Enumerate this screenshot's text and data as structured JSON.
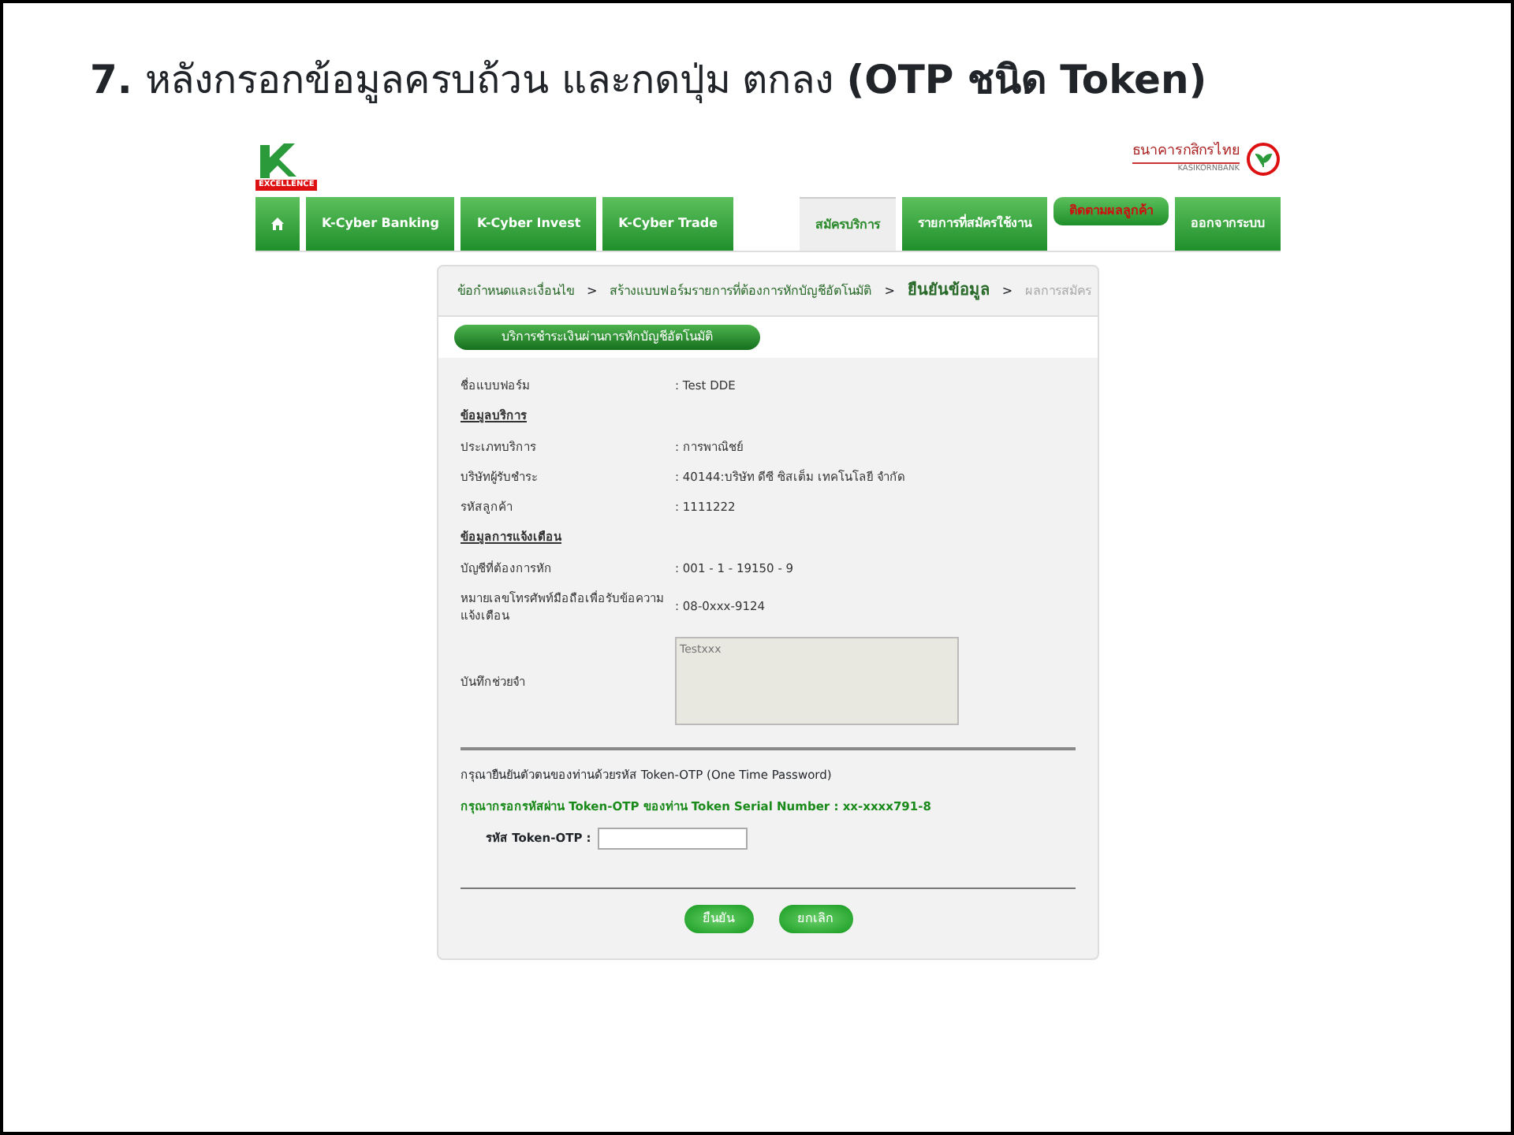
{
  "slide": {
    "title": "**7.** หลังกรอกข้อมูลครบถ้วน และกดปุ่ม ตกลง **(OTP ชนิด Token)**"
  },
  "header": {
    "logo_caption": "EXCELLENCE",
    "bank_name": "ธนาคารกสิกรไทย",
    "bank_name_en": "KASIKORNBANK"
  },
  "nav_left": [
    {
      "kind": "home"
    },
    {
      "kind": "text",
      "label": "K-Cyber Banking"
    },
    {
      "kind": "text",
      "label": "K-Cyber Invest"
    },
    {
      "kind": "text",
      "label": "K-Cyber Trade"
    }
  ],
  "nav_right": [
    {
      "label": "สมัครบริการ",
      "selected": true,
      "kind": "normal"
    },
    {
      "label": "รายการที่สมัครใช้งาน",
      "selected": false,
      "kind": "normal"
    },
    {
      "label": "ติดตามผลลูกค้า",
      "selected": false,
      "kind": "alert"
    },
    {
      "label": "ออกจากระบบ",
      "selected": false,
      "kind": "normal"
    }
  ],
  "breadcrumb": [
    {
      "label": "ข้อกำหนดและเงื่อนไข",
      "selected": false,
      "done": true
    },
    {
      "separator": ">",
      "label": "สร้างแบบฟอร์มรายการที่ต้องการหักบัญชีอัตโนมัติ",
      "selected": false,
      "done": true
    },
    {
      "separator": ">",
      "label": "ยืนยันข้อมูล",
      "selected": true,
      "done": false
    },
    {
      "separator": ">",
      "label": "ผลการสมัคร",
      "selected": false,
      "done": false
    }
  ],
  "section_title": "บริการชำระเงินผ่านการหักบัญชีอัตโนมัติ",
  "rows": [
    {
      "kind": "field",
      "label": "ชื่อแบบฟอร์ม",
      "value": ": Test DDE"
    },
    {
      "kind": "heading",
      "label": "ข้อมูลบริการ"
    },
    {
      "kind": "field",
      "label": "ประเภทบริการ",
      "value": ": การพาณิชย์"
    },
    {
      "kind": "field",
      "label": "บริษัทผู้รับชำระ",
      "value": ": 40144:บริษัท ดีซี ซิสเต็ม เทคโนโลยี จำกัด"
    },
    {
      "kind": "field",
      "label": "รหัสลูกค้า",
      "value": ": 1111222"
    },
    {
      "kind": "heading",
      "label": "ข้อมูลการแจ้งเตือน"
    },
    {
      "kind": "field",
      "label": "บัญชีที่ต้องการหัก",
      "value": ": 001 - 1 - 19150 - 9"
    },
    {
      "kind": "field",
      "label": "หมายเลขโทรศัพท์มือถือเพื่อรับข้อความแจ้งเตือน",
      "value": ": 08-0xxx-9124"
    },
    {
      "kind": "textarea",
      "label": "บันทึกช่วยจำ",
      "placeholder": "Testxxx"
    }
  ],
  "otp": {
    "prompt": "กรุณายืนยันตัวตนของท่านด้วยรหัส Token-OTP (One Time Password)",
    "instruction": "กรุณากรอกรหัสผ่าน Token-OTP ของท่าน Token Serial Number : xx-xxxx791-8",
    "field_label": "รหัส Token-OTP :"
  },
  "buttons": [
    "ยืนยัน",
    "ยกเลิก"
  ]
}
